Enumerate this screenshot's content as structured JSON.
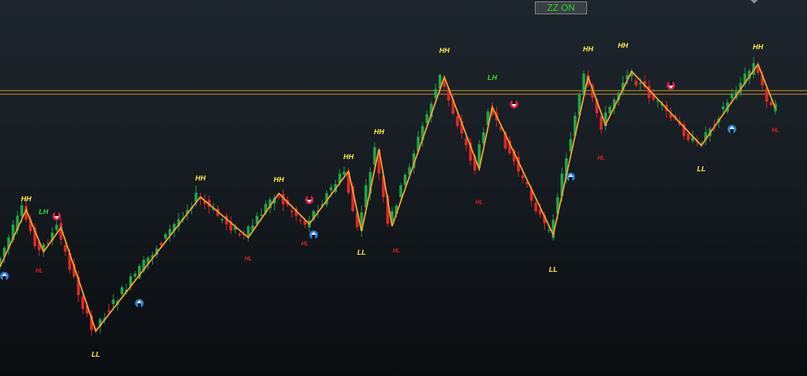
{
  "toggle": {
    "label": "ZZ ON"
  },
  "colors": {
    "zigzag": "#f0a030",
    "bull": "#1fa64a",
    "bear": "#e02828",
    "hh_ll": "#ffee33",
    "lh": "#33dd33",
    "hl": "#e02020",
    "up_arrow": "#2f7fd8",
    "down_arrow": "#d02040",
    "hline": "#d8a020"
  },
  "chart_data": {
    "type": "candlestick",
    "title": "",
    "xlabel": "",
    "ylabel": "",
    "grid": false,
    "y_axis": "hidden",
    "x_axis": "hidden",
    "zigzag": [
      {
        "bar": 0,
        "price": 374
      },
      {
        "bar": 6,
        "price": 294
      },
      {
        "bar": 10,
        "price": 353
      },
      {
        "bar": 14,
        "price": 319
      },
      {
        "bar": 22,
        "price": 464
      },
      {
        "bar": 46,
        "price": 276
      },
      {
        "bar": 57,
        "price": 333
      },
      {
        "bar": 64,
        "price": 271
      },
      {
        "bar": 71,
        "price": 314
      },
      {
        "bar": 80,
        "price": 240
      },
      {
        "bar": 83,
        "price": 324
      },
      {
        "bar": 87,
        "price": 209
      },
      {
        "bar": 90,
        "price": 317
      },
      {
        "bar": 102,
        "price": 108
      },
      {
        "bar": 110,
        "price": 237
      },
      {
        "bar": 113,
        "price": 150
      },
      {
        "bar": 127,
        "price": 329
      },
      {
        "bar": 135,
        "price": 108
      },
      {
        "bar": 139,
        "price": 175
      },
      {
        "bar": 145,
        "price": 100
      },
      {
        "bar": 161,
        "price": 204
      },
      {
        "bar": 174,
        "price": 90
      },
      {
        "bar": 178,
        "price": 152
      }
    ],
    "swing_labels": [
      {
        "text": "HH",
        "bar": 6,
        "price": 282,
        "kind": "hh_ll"
      },
      {
        "text": "LH",
        "bar": 10,
        "price": 300,
        "kind": "lh"
      },
      {
        "text": "HL",
        "bar": 9,
        "price": 382,
        "kind": "hl"
      },
      {
        "text": "LL",
        "bar": 22,
        "price": 500,
        "kind": "hh_ll"
      },
      {
        "text": "HH",
        "bar": 46,
        "price": 253,
        "kind": "hh_ll"
      },
      {
        "text": "HL",
        "bar": 57,
        "price": 365,
        "kind": "hl"
      },
      {
        "text": "HH",
        "bar": 64,
        "price": 255,
        "kind": "hh_ll"
      },
      {
        "text": "HL",
        "bar": 70,
        "price": 344,
        "kind": "hl"
      },
      {
        "text": "HH",
        "bar": 80,
        "price": 223,
        "kind": "hh_ll"
      },
      {
        "text": "LL",
        "bar": 83,
        "price": 357,
        "kind": "hh_ll"
      },
      {
        "text": "HH",
        "bar": 87,
        "price": 188,
        "kind": "hh_ll"
      },
      {
        "text": "HL",
        "bar": 91,
        "price": 354,
        "kind": "hl"
      },
      {
        "text": "HH",
        "bar": 102,
        "price": 74,
        "kind": "hh_ll"
      },
      {
        "text": "LH",
        "bar": 113,
        "price": 112,
        "kind": "lh"
      },
      {
        "text": "HL",
        "bar": 110,
        "price": 286,
        "kind": "hl"
      },
      {
        "text": "LL",
        "bar": 127,
        "price": 381,
        "kind": "hh_ll"
      },
      {
        "text": "HH",
        "bar": 135,
        "price": 72,
        "kind": "hh_ll"
      },
      {
        "text": "HL",
        "bar": 138,
        "price": 224,
        "kind": "hl"
      },
      {
        "text": "HH",
        "bar": 143,
        "price": 67,
        "kind": "hh_ll"
      },
      {
        "text": "LL",
        "bar": 161,
        "price": 240,
        "kind": "hh_ll"
      },
      {
        "text": "HH",
        "bar": 174,
        "price": 69,
        "kind": "hh_ll"
      },
      {
        "text": "HL",
        "bar": 178,
        "price": 185,
        "kind": "hl"
      }
    ],
    "arrows": [
      {
        "bar": 1,
        "price": 387,
        "dir": "up"
      },
      {
        "bar": 13,
        "price": 303,
        "dir": "down"
      },
      {
        "bar": 32,
        "price": 425,
        "dir": "up"
      },
      {
        "bar": 71,
        "price": 280,
        "dir": "down"
      },
      {
        "bar": 72,
        "price": 329,
        "dir": "up"
      },
      {
        "bar": 118,
        "price": 146,
        "dir": "down"
      },
      {
        "bar": 131,
        "price": 248,
        "dir": "up"
      },
      {
        "bar": 154,
        "price": 120,
        "dir": "down"
      },
      {
        "bar": 168,
        "price": 181,
        "dir": "up"
      }
    ],
    "horizontal_lines": [
      {
        "price": 127
      },
      {
        "price": 132
      }
    ]
  }
}
